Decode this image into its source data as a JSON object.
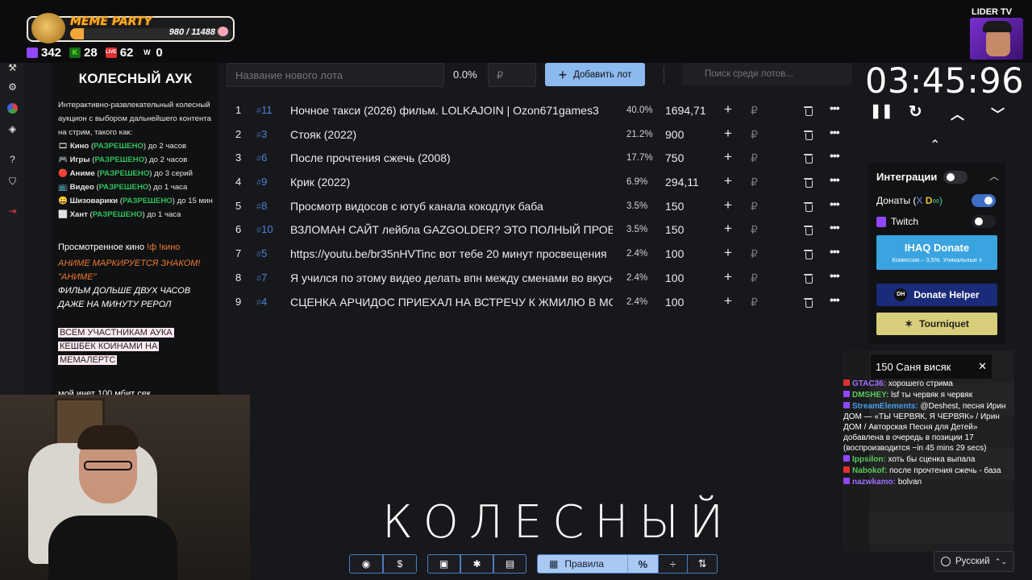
{
  "header": {
    "meme_party_title": "MEME PARTY",
    "meme_party_count": "980 / 11488",
    "meme_party_progress": 0.085,
    "stats": [
      {
        "icon": "twitch-icon",
        "value": "342",
        "color": "#9146ff"
      },
      {
        "icon": "kick-icon",
        "value": "28",
        "color": "#53fc18"
      },
      {
        "icon": "vklive-icon",
        "value": "62",
        "color": "#e03030"
      },
      {
        "icon": "w-icon",
        "value": "0",
        "color": "#ffffff"
      }
    ],
    "lider_tv": "LIDER TV"
  },
  "description": {
    "title": "КОЛЕСНЫЙ АУК",
    "intro": "Интерактивно-развлекательный колесный аукцион с выбором дальнейшего контента на стрим, такого как:",
    "rules": [
      {
        "emoji": "🎞",
        "name": "Кино",
        "status": "РАЗРЕШЕНО",
        "limit": "до 2 часов"
      },
      {
        "emoji": "🎮",
        "name": "Игры",
        "status": "РАЗРЕШЕНО",
        "limit": "до 2 часов"
      },
      {
        "emoji": "🔴",
        "name": "Аниме",
        "status": "РАЗРЕШЕНО",
        "limit": "до 3 серий"
      },
      {
        "emoji": "📺",
        "name": "Видео",
        "status": "РАЗРЕШЕНО",
        "limit": "до 1 часа"
      },
      {
        "emoji": "😀",
        "name": "Шизоварики",
        "status": "РАЗРЕШЕНО",
        "limit": "до 15 мин"
      },
      {
        "emoji": "⬜",
        "name": "Хант",
        "status": "РАЗРЕШЕНО",
        "limit": "до 1 часа"
      }
    ],
    "watched_prefix": "Просмотренное кино",
    "watched_cmd": "!ф !кино",
    "anime_note": "АНИМЕ МАРКИРУЕТСЯ ЗНАКОМ! \"АНИМЕ\"",
    "film_note": "ФИЛЬМ ДОЛЬШЕ ДВУХ ЧАСОВ ДАЖЕ НА МИНУТУ РЕРОЛ",
    "cashback": [
      "ВСЕМ УЧАСТНИКАМ АУКА",
      "КЕШБЕК КОИНАМИ НА",
      "МЕМАЛЕРТС"
    ],
    "inet": "мой инет 100 мбит сек"
  },
  "toolbar": {
    "lot_name_placeholder": "Название нового лота",
    "percent": "0.0%",
    "rub_placeholder": "₽",
    "add_lot_label": "Добавить лот",
    "search_placeholder": "Поиск среди лотов..."
  },
  "lots": [
    {
      "num": "1",
      "id": "11",
      "name": "Ночное такси (2026) фильм. LOLKAJOIN | Ozon671games3",
      "percent": "40.0%",
      "amount": "1694,71"
    },
    {
      "num": "2",
      "id": "3",
      "name": "Стояк (2022)",
      "percent": "21.2%",
      "amount": "900"
    },
    {
      "num": "3",
      "id": "6",
      "name": "После прочтения сжечь (2008)",
      "percent": "17.7%",
      "amount": "750"
    },
    {
      "num": "4",
      "id": "9",
      "name": "Крик (2022)",
      "percent": "6.9%",
      "amount": "294,11"
    },
    {
      "num": "5",
      "id": "8",
      "name": "Просмотр видосов с ютуб канала кокодлук баба",
      "percent": "3.5%",
      "amount": "150"
    },
    {
      "num": "6",
      "id": "10",
      "name": " ВЗЛОМАН САЙТ лейбла GAZGOLDER? ЭТО ПОЛНЫЙ ПРОВ",
      "percent": "3.5%",
      "amount": "150"
    },
    {
      "num": "7",
      "id": "5",
      "name": "https://youtu.be/br35nHVTinc вот тебе 20 минут просвещения",
      "percent": "2.4%",
      "amount": "100"
    },
    {
      "num": "8",
      "id": "7",
      "name": "Я учился по этому видео делать впн между сменами во вкусно",
      "percent": "2.4%",
      "amount": "100"
    },
    {
      "num": "9",
      "id": "4",
      "name": "СЦЕНКА АРЧИДОС ПРИЕХАЛ НА ВСТРЕЧУ К ЖМИЛЮ В МОСКВУ",
      "percent": "2.4%",
      "amount": "100"
    }
  ],
  "lot_symbols": {
    "hash": "#",
    "plus": "+",
    "rub": "₽",
    "more": "•••"
  },
  "timer": {
    "value": "03:45:96",
    "pause": "❚❚",
    "reset": "↻",
    "up": "︿",
    "down": "﹀",
    "collapse": "⌃"
  },
  "integrations": {
    "title": "Интеграции",
    "donations_label": "Донаты (",
    "donations_logo": "D",
    "donations_x": "X",
    "donations_end": "∞)",
    "twitch_label": "Twitch",
    "ihaq_title": "IHAQ Donate",
    "ihaq_sub": "Комиссия – 3,5%. Уникальные з",
    "donate_helper": "Donate Helper",
    "dh_badge": "DH",
    "tourniquet": "Tourniquet",
    "tourniquet_icon": "✶"
  },
  "chat": {
    "popup": "150 Саня висяк",
    "close": "✕",
    "lines": [
      {
        "badge": "vklive",
        "nick": "GTAC36:",
        "nick_color": "#a070ff",
        "text": "хорошего стрима"
      },
      {
        "badge": "twitch",
        "nick": "DMSHEY:",
        "nick_color": "#5cc85c",
        "text": "lsf ты червяк я червяк"
      },
      {
        "badge": "twitch",
        "nick": "StreamElements:",
        "nick_color": "#4a9ee8",
        "text": "@Deshest, песня Ирин ДОМ — «ТЫ ЧЕРВЯК, Я ЧЕРВЯК» / Ирин ДОМ / Авторская Песня для Детей» добавлена в очередь в позиции 17 (воспроизводится ~in 45 mins 29 secs)"
      },
      {
        "badge": "twitch",
        "nick": "Ippsilon:",
        "nick_color": "#5cc85c",
        "text": "хоть бы сценка выпала"
      },
      {
        "badge": "vklive",
        "nick": "Nabokof:",
        "nick_color": "#5cc85c",
        "text": "после прочтения сжечь - база"
      },
      {
        "badge": "twitch",
        "nick": "nazwkamo:",
        "nick_color": "#a070ff",
        "text": "bolvan"
      }
    ]
  },
  "subtitle": "КОЛЕСНЫЙ",
  "bottom": {
    "rules_label": "Правила",
    "percent_symbol": "%",
    "split_symbol": "÷",
    "swap_symbol": "⇅",
    "github_symbol": "◉",
    "dollar_symbol": "$",
    "box_symbol": "▣",
    "bug_symbol": "✱",
    "trash_symbol": "▤",
    "language": "Русский",
    "lang_arrow": "⌃⌄"
  }
}
